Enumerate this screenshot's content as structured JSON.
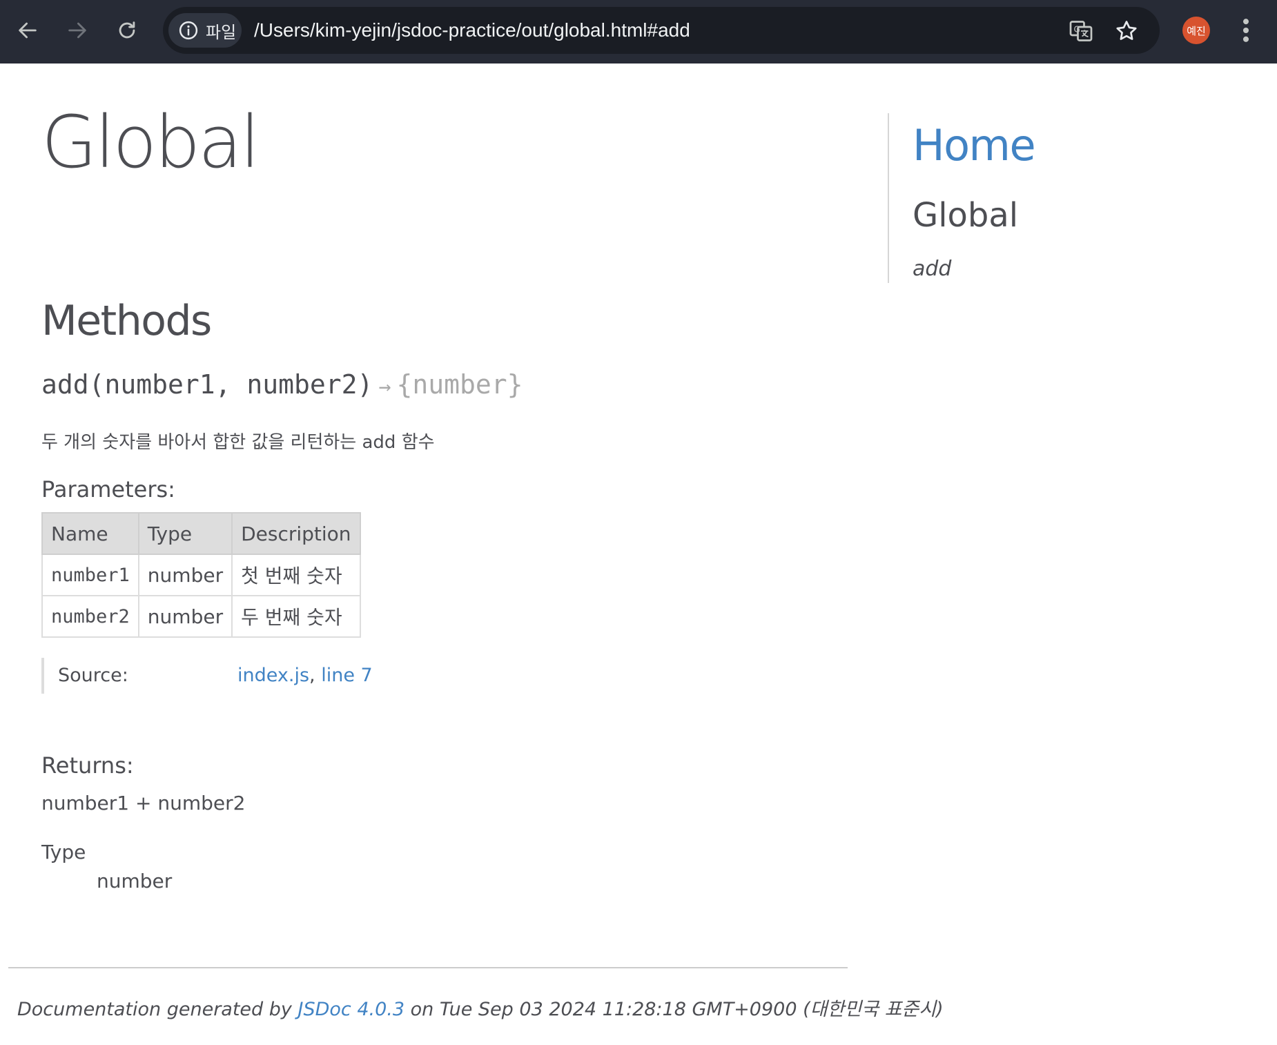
{
  "browser": {
    "site_chip_label": "파일",
    "url": "/Users/kim-yejin/jsdoc-practice/out/global.html#add",
    "avatar_text": "예진",
    "icons": [
      "back-arrow-icon",
      "forward-arrow-icon",
      "reload-icon",
      "info-icon",
      "translate-icon",
      "star-icon",
      "more-menu-icon"
    ]
  },
  "page": {
    "title": "Global",
    "methods_heading": "Methods",
    "method": {
      "name_and_params": "add(number1, number2)",
      "arrow": "→",
      "return_type": "{number}",
      "description": "두 개의 숫자를 바아서 합한 값을 리턴하는 add 함수",
      "parameters_heading": "Parameters:",
      "param_headers": [
        "Name",
        "Type",
        "Description"
      ],
      "params": [
        {
          "name": "number1",
          "type": "number",
          "description": "첫 번째 숫자"
        },
        {
          "name": "number2",
          "type": "number",
          "description": "두 번째 숫자"
        }
      ],
      "source_label": "Source:",
      "source_file": "index.js",
      "source_sep": ",",
      "source_line": "line 7",
      "returns_heading": "Returns:",
      "returns_value": "number1 + number2",
      "type_label": "Type",
      "type_value": "number"
    }
  },
  "nav": {
    "home": "Home",
    "group": "Global",
    "item": "add"
  },
  "footer": {
    "prefix": "Documentation generated by",
    "link": "JSDoc 4.0.3",
    "suffix": "on Tue Sep 03 2024 11:28:18 GMT+0900 (대한민국 표준시)"
  },
  "colors": {
    "toolbar": "#272b36",
    "link": "#4183c4",
    "text": "#4d4e53",
    "table_header": "#dddddd",
    "avatar": "#d8532f"
  }
}
